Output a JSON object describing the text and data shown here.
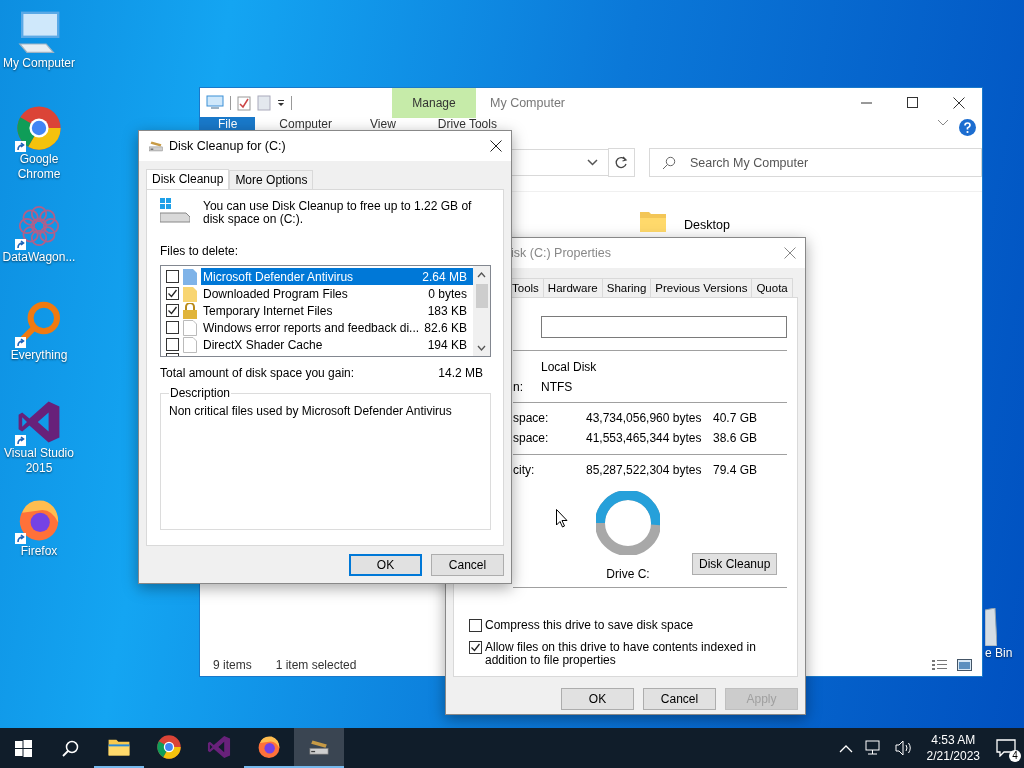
{
  "desktop": {
    "icons": [
      {
        "label": "My Computer",
        "kind": "computer",
        "shortcut": false
      },
      {
        "label": "Google Chrome",
        "kind": "chrome",
        "shortcut": true
      },
      {
        "label": "DataWagon...",
        "kind": "datawagon",
        "shortcut": true
      },
      {
        "label": "Everything",
        "kind": "everything",
        "shortcut": true
      },
      {
        "label": "Visual Studio 2015",
        "kind": "vs",
        "shortcut": true
      },
      {
        "label": "Firefox",
        "kind": "firefox",
        "shortcut": true
      }
    ],
    "recycle_bin": {
      "label": "e Bin"
    }
  },
  "explorer": {
    "title": "My Computer",
    "context_tab": "Manage",
    "ribbon_tabs": [
      {
        "label": "File",
        "selected": true
      },
      {
        "label": "Computer",
        "selected": false
      },
      {
        "label": "View",
        "selected": false
      },
      {
        "label": "Drive Tools",
        "selected": false
      }
    ],
    "search": {
      "placeholder": "Search My Computer"
    },
    "items": [
      {
        "label": "Desktop"
      }
    ],
    "status": {
      "count": "9 items",
      "selection": "1 item selected"
    }
  },
  "properties": {
    "title": "isk (C:) Properties",
    "tabs": [
      {
        "label": "Tools",
        "selected": false
      },
      {
        "label": "Hardware",
        "selected": false
      },
      {
        "label": "Sharing",
        "selected": false
      },
      {
        "label": "Previous Versions",
        "selected": false
      },
      {
        "label": "Quota",
        "selected": false
      }
    ],
    "type_value": "Local Disk",
    "fs_label": "n:",
    "fs_value": "NTFS",
    "space_rows": [
      {
        "label": "space:",
        "bytes": "43,734,056,960 bytes",
        "size": "40.7 GB"
      },
      {
        "label": "space:",
        "bytes": "41,553,465,344 bytes",
        "size": "38.6 GB"
      }
    ],
    "capacity": {
      "label": "city:",
      "bytes": "85,287,522,304 bytes",
      "size": "79.4 GB"
    },
    "usage": {
      "level": 0.51
    },
    "drive_label": "Drive C:",
    "cleanup_button": "Disk Cleanup",
    "options": [
      {
        "label": "Compress this drive to save disk space",
        "checked": false
      },
      {
        "label": "Allow files on this drive to have contents indexed in addition to file properties",
        "checked": true
      }
    ],
    "buttons": [
      {
        "label": "OK",
        "disabled": false
      },
      {
        "label": "Cancel",
        "disabled": false
      },
      {
        "label": "Apply",
        "disabled": true
      }
    ]
  },
  "cleanup": {
    "title": "Disk Cleanup for  (C:)",
    "tabs": [
      {
        "label": "Disk Cleanup",
        "selected": true
      },
      {
        "label": "More Options",
        "selected": false
      }
    ],
    "intro": "You can use Disk Cleanup to free up to 1.22 GB of disk space on  (C:).",
    "files_label": "Files to delete:",
    "files": [
      {
        "name": "Microsoft Defender Antivirus",
        "size": "2.64 MB",
        "checked": false,
        "selected": true,
        "kind": "blue"
      },
      {
        "name": "Downloaded Program Files",
        "size": "0 bytes",
        "checked": true,
        "selected": false,
        "kind": "folder"
      },
      {
        "name": "Temporary Internet Files",
        "size": "183 KB",
        "checked": true,
        "selected": false,
        "kind": "lock"
      },
      {
        "name": "Windows error reports and feedback di...",
        "size": "82.6 KB",
        "checked": false,
        "selected": false,
        "kind": "page"
      },
      {
        "name": "DirectX Shader Cache",
        "size": "194 KB",
        "checked": false,
        "selected": false,
        "kind": "page"
      }
    ],
    "total_label": "Total amount of disk space you gain:",
    "total_value": "14.2 MB",
    "description_legend": "Description",
    "description": "Non critical files used by Microsoft Defender Antivirus",
    "buttons": [
      {
        "label": "OK",
        "default": true
      },
      {
        "label": "Cancel",
        "default": false
      }
    ]
  },
  "taskbar": {
    "apps": [
      {
        "kind": "explorer",
        "running": true,
        "selected": false
      },
      {
        "kind": "chrome",
        "running": false,
        "selected": false
      },
      {
        "kind": "vs",
        "running": false,
        "selected": false
      },
      {
        "kind": "firefox",
        "running": true,
        "selected": false
      },
      {
        "kind": "cleanup",
        "running": true,
        "selected": true
      }
    ],
    "time": "4:53 AM",
    "date": "2/21/2023",
    "notifications": "4"
  }
}
